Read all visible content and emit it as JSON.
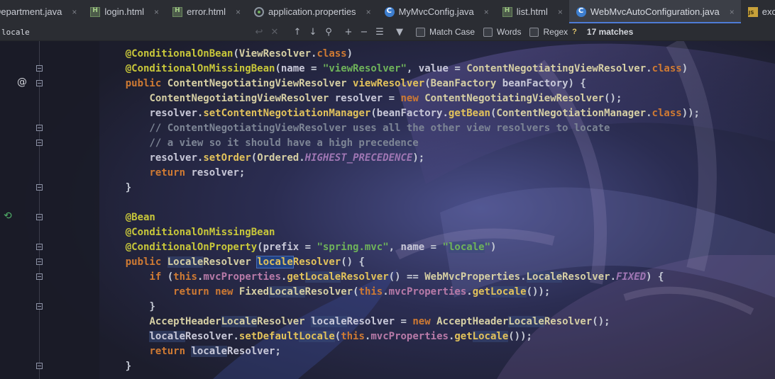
{
  "tabs": [
    {
      "name": "Department.java",
      "icon": "java",
      "close": "×"
    },
    {
      "name": "login.html",
      "icon": "html",
      "close": "×"
    },
    {
      "name": "error.html",
      "icon": "html",
      "close": "×"
    },
    {
      "name": "application.properties",
      "icon": "properties",
      "close": "×"
    },
    {
      "name": "MyMvcConfig.java",
      "icon": "java",
      "close": "×"
    },
    {
      "name": "list.html",
      "icon": "html",
      "close": "×"
    },
    {
      "name": "WebMvcAutoConfiguration.java",
      "icon": "java",
      "close": "×"
    },
    {
      "name": "excanvas.js",
      "icon": "js",
      "close": "×"
    }
  ],
  "search": {
    "query": "locale",
    "match_case_label": "Match Case",
    "words_label": "Words",
    "regex_label": "Regex",
    "help": "?",
    "matches": "17 matches"
  },
  "colors": {
    "annotation": "#c8c73a",
    "keyword": "#cf7a33",
    "string": "#6fb35a",
    "field": "#b87aa8",
    "comment": "#7d8595",
    "search_highlight": "#394b78",
    "current_match": "#214283"
  },
  "code_lines": [
    "    @ConditionalOnBean(ViewResolver.class)",
    "    @ConditionalOnMissingBean(name = \"viewResolver\", value = ContentNegotiatingViewResolver.class)",
    "    public ContentNegotiatingViewResolver viewResolver(BeanFactory beanFactory) {",
    "        ContentNegotiatingViewResolver resolver = new ContentNegotiatingViewResolver();",
    "        resolver.setContentNegotiationManager(beanFactory.getBean(ContentNegotiationManager.class));",
    "        // ContentNegotiatingViewResolver uses all the other view resolvers to locate",
    "        // a view so it should have a high precedence",
    "        resolver.setOrder(Ordered.HIGHEST_PRECEDENCE);",
    "        return resolver;",
    "    }",
    "",
    "    @Bean",
    "    @ConditionalOnMissingBean",
    "    @ConditionalOnProperty(prefix = \"spring.mvc\", name = \"locale\")",
    "    public LocaleResolver localeResolver() {",
    "        if (this.mvcProperties.getLocaleResolver() == WebMvcProperties.LocaleResolver.FIXED) {",
    "            return new FixedLocaleResolver(this.mvcProperties.getLocale());",
    "        }",
    "        AcceptHeaderLocaleResolver localeResolver = new AcceptHeaderLocaleResolver();",
    "        localeResolver.setDefaultLocale(this.mvcProperties.getLocale());",
    "        return localeResolver;",
    "    }"
  ]
}
